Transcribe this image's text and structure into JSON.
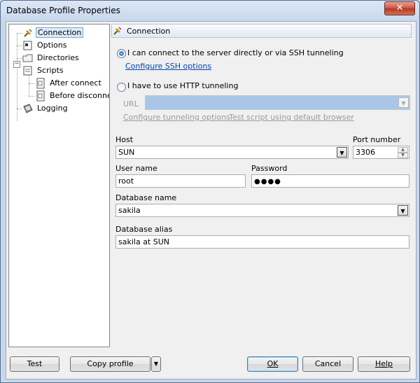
{
  "window": {
    "title": "Database Profile Properties",
    "close_label": "✕"
  },
  "tree": {
    "items": [
      {
        "label": "Connection",
        "icon": "connection-plug-icon"
      },
      {
        "label": "Options",
        "icon": "options-icon"
      },
      {
        "label": "Directories",
        "icon": "folder-icon"
      },
      {
        "label": "Scripts",
        "icon": "scripts-icon",
        "expander": "−"
      },
      {
        "label": "After connect",
        "icon": "script-file-icon"
      },
      {
        "label": "Before disconnect",
        "icon": "script-file-icon"
      },
      {
        "label": "Logging",
        "icon": "logging-icon"
      }
    ]
  },
  "panel": {
    "header": "Connection",
    "radio_direct": "I can connect to the server directly or via SSH tunneling",
    "configure_ssh": "Configure SSH options",
    "radio_http": "I have to use HTTP tunneling",
    "url_label": "URL",
    "url_value": "",
    "configure_tunneling": "Configure tunneling options",
    "test_script": "Test script using default browser",
    "host_label": "Host",
    "host_value": "SUN",
    "port_label": "Port number",
    "port_value": "3306",
    "username_label": "User name",
    "username_value": "root",
    "password_label": "Password",
    "password_value": "●●●●",
    "dbname_label": "Database name",
    "dbname_value": "sakila",
    "alias_label": "Database alias",
    "alias_value": "sakila at SUN"
  },
  "buttons": {
    "test": "Test",
    "copy_profile": "Copy profile",
    "ok": "OK",
    "cancel": "Cancel",
    "help": "Help"
  },
  "colors": {
    "selection": "#dbeaf9",
    "link": "#0645ad",
    "url_bg": "#a9c6e6"
  }
}
